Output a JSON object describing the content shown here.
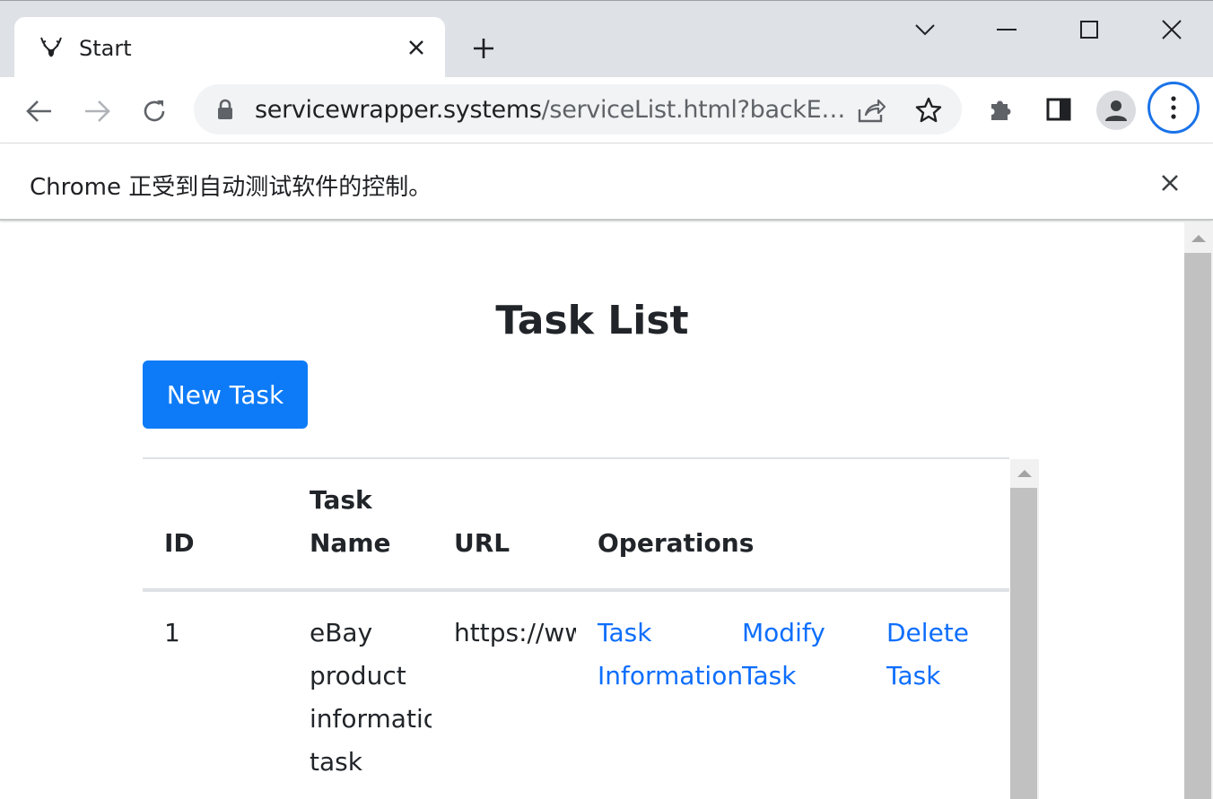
{
  "browser": {
    "tab_title": "Start",
    "url_host": "servicewrapper.systems",
    "url_rest": "/serviceList.html?backE…",
    "infobar_text": "Chrome 正受到自动测试软件的控制。",
    "accent_color": "#1a73e8"
  },
  "page": {
    "title": "Task List",
    "new_task_button": "New Task",
    "table": {
      "headers": [
        "ID",
        "Task Name",
        "URL",
        "Operations"
      ],
      "rows": [
        {
          "id": "1",
          "task_name": "eBay product information task",
          "url": "https://www.ebay.com",
          "ops": [
            "Task Information",
            "Modify Task",
            "Delete Task"
          ]
        }
      ]
    },
    "primary_color": "#0d7bf7",
    "link_color": "#0d6efd"
  }
}
